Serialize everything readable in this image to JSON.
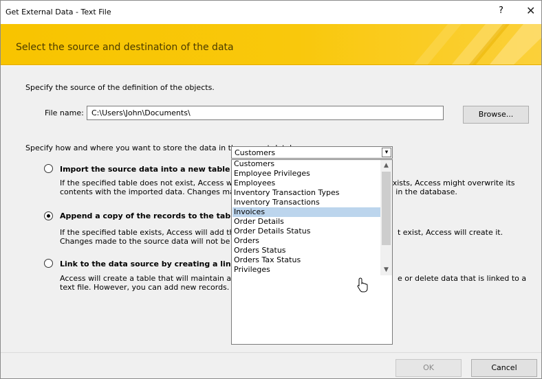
{
  "window": {
    "title": "Get External Data - Text File",
    "help_glyph": "?",
    "close_glyph": "✕"
  },
  "banner": {
    "heading": "Select the source and destination of the data"
  },
  "source": {
    "intro": "Specify the source of the definition of the objects.",
    "file_label": "File name:",
    "file_value": "C:\\Users\\John\\Documents\\",
    "browse_label": "Browse..."
  },
  "storage": {
    "intro": "Specify how and where you want to store the data in the current database.",
    "options": [
      {
        "label": "Import the source data into a new table in the current database.",
        "desc1": "If the specified table does not exist, Access will create it. If the specified table already exists, Access might overwrite its",
        "desc2": "contents with the imported data. Changes made to the source data will not be reflected in the database.",
        "selected": false
      },
      {
        "label": "Append a copy of the records to the table:",
        "desc1a": "If the specified table exists, Access will add th",
        "desc1b": "t exist, Access will create it.",
        "desc2": "Changes made to the source data will not be",
        "selected": true
      },
      {
        "label": "Link to the data source by creating a linked t",
        "desc1a": "Access will create a table that will maintain a",
        "desc1b": "e or delete data that is linked to a",
        "desc2": "text file. However, you can add new records.",
        "selected": false
      }
    ]
  },
  "table_combo": {
    "value": "Customers",
    "items": [
      "Customers",
      "Employee Privileges",
      "Employees",
      "Inventory Transaction Types",
      "Inventory Transactions",
      "Invoices",
      "Order Details",
      "Order Details Status",
      "Orders",
      "Orders Status",
      "Orders Tax Status",
      "Privileges"
    ],
    "highlighted": "Invoices"
  },
  "footer": {
    "ok_label": "OK",
    "cancel_label": "Cancel"
  },
  "colors": {
    "banner": "#f8c400",
    "selection": "#bcd5ed"
  }
}
